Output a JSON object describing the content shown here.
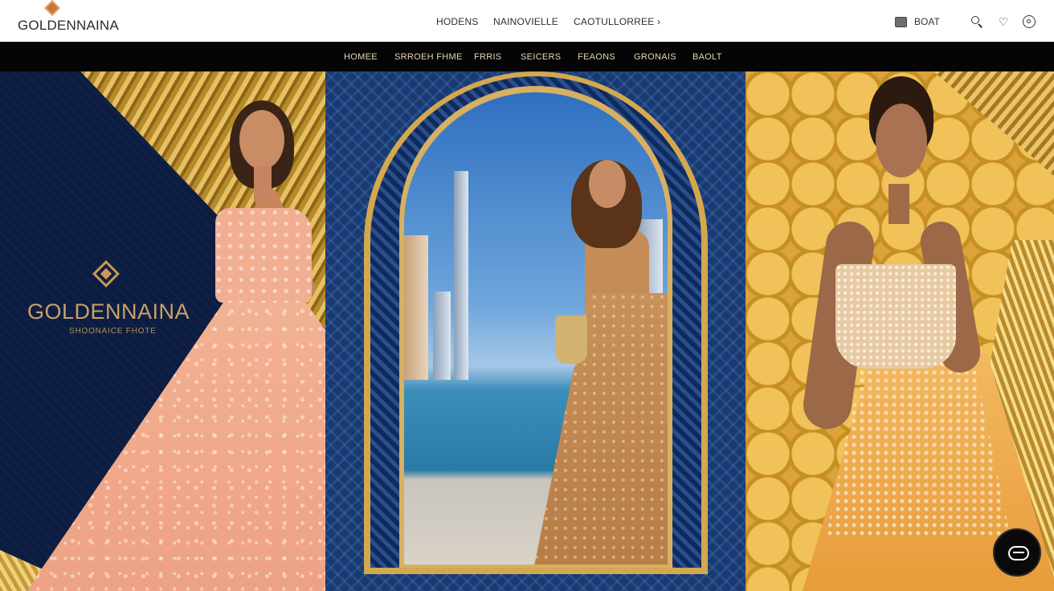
{
  "brand": {
    "name": "GOLDENNAINA",
    "logo_icon": "diamond-logo-icon",
    "logo_color": "#c8743f"
  },
  "header": {
    "nav": [
      {
        "label": "HODENS"
      },
      {
        "label": "NAINOVIELLE"
      },
      {
        "label": "CAOTULLORREE ›"
      }
    ],
    "cart": {
      "label": "BOAT",
      "icon": "cart-icon"
    },
    "icons": [
      "search-icon",
      "heart-icon",
      "account-icon"
    ]
  },
  "category_bar": {
    "items": [
      {
        "label": "HOMEE"
      },
      {
        "label": "SRROEH FHME"
      },
      {
        "label": "FRRIS"
      },
      {
        "label": "SEICERS"
      },
      {
        "label": "FEAONS"
      },
      {
        "label": "GRONAIS"
      },
      {
        "label": "BAOLT"
      }
    ],
    "text_color": "#e6d7b4"
  },
  "hero": {
    "brand_name": "GOLDENNAINA",
    "tagline": "SHOONAICE FHOTE",
    "accent_gold": "#c9a06a",
    "navy": "#0d1d42"
  },
  "chat": {
    "icon": "chat-icon"
  }
}
